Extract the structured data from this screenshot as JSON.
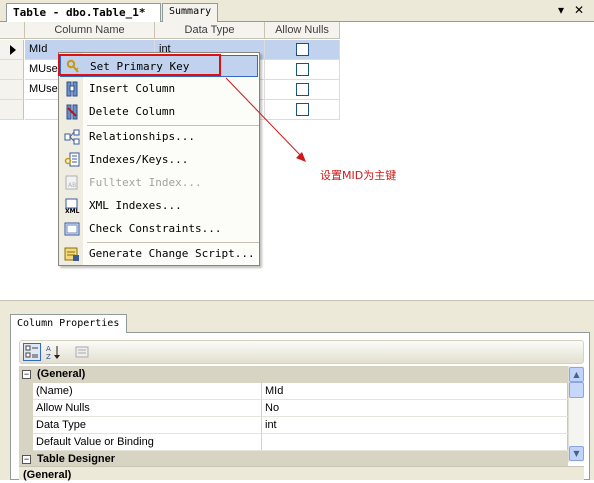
{
  "tabs": [
    {
      "label": "Table - dbo.Table_1*"
    },
    {
      "label": "Summary"
    }
  ],
  "window_controls": {
    "dropdown": "▾",
    "close": "✕"
  },
  "grid": {
    "columns": [
      "Column Name",
      "Data Type",
      "Allow Nulls"
    ],
    "rows": [
      {
        "name": "MId",
        "type": "int",
        "allow_nulls": false,
        "selected": true
      },
      {
        "name": "MUser",
        "type": "",
        "allow_nulls": false,
        "selected": false
      },
      {
        "name": "MUser",
        "type": "",
        "allow_nulls": false,
        "selected": false
      },
      {
        "name": "",
        "type": "",
        "allow_nulls": false,
        "selected": false
      }
    ]
  },
  "context_menu": {
    "items": [
      {
        "label": "Set Primary Key",
        "icon": "key-icon",
        "highlighted": true,
        "disabled": false
      },
      {
        "label": "Insert Column",
        "icon": "insert-column-icon",
        "highlighted": false,
        "disabled": false
      },
      {
        "label": "Delete Column",
        "icon": "delete-column-icon",
        "highlighted": false,
        "disabled": false
      },
      {
        "label": "Relationships...",
        "icon": "relationships-icon",
        "highlighted": false,
        "disabled": false
      },
      {
        "label": "Indexes/Keys...",
        "icon": "indexes-icon",
        "highlighted": false,
        "disabled": false
      },
      {
        "label": "Fulltext Index...",
        "icon": "fulltext-icon",
        "highlighted": false,
        "disabled": true
      },
      {
        "label": "XML Indexes...",
        "icon": "xml-icon",
        "highlighted": false,
        "disabled": false
      },
      {
        "label": "Check Constraints...",
        "icon": "check-constraints-icon",
        "highlighted": false,
        "disabled": false
      },
      {
        "label": "Generate Change Script...",
        "icon": "script-icon",
        "highlighted": false,
        "disabled": false
      }
    ]
  },
  "annotation": {
    "text": "设置MID为主键",
    "color": "#d01818"
  },
  "properties": {
    "tab_label": "Column Properties",
    "categories": [
      {
        "name": "(General)",
        "rows": [
          {
            "name": "(Name)",
            "value": "MId"
          },
          {
            "name": "Allow Nulls",
            "value": "No"
          },
          {
            "name": "Data Type",
            "value": "int"
          },
          {
            "name": "Default Value or Binding",
            "value": ""
          }
        ]
      },
      {
        "name": "Table Designer",
        "rows": []
      }
    ],
    "description_title": "(General)"
  },
  "colors": {
    "highlight": "#c1d2ee",
    "accent_border": "#316ac5",
    "callout_red": "#e01010"
  }
}
